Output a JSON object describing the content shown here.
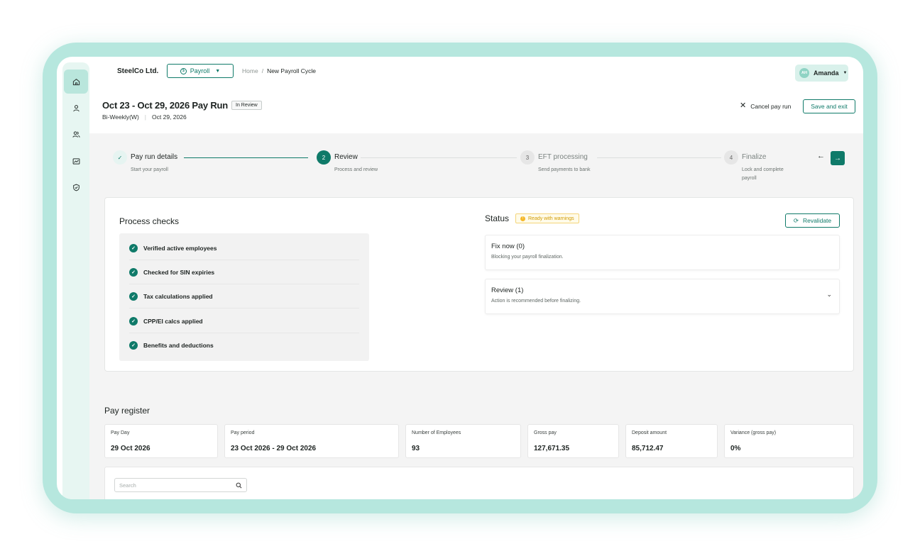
{
  "header": {
    "company": "SteelCo Ltd.",
    "module": "Payroll",
    "breadcrumb": {
      "home": "Home",
      "separator": "/",
      "current": "New Payroll Cycle"
    },
    "user": {
      "initials": "AH",
      "name": "Amanda"
    }
  },
  "sidebar": {
    "items": [
      {
        "icon": "home-icon",
        "active": true
      },
      {
        "icon": "person-icon",
        "active": false
      },
      {
        "icon": "people-icon",
        "active": false
      },
      {
        "icon": "chart-icon",
        "active": false
      },
      {
        "icon": "shield-icon",
        "active": false
      }
    ]
  },
  "run": {
    "title": "Oct 23 - Oct 29, 2026 Pay Run",
    "status": "In Review",
    "frequency": "Bi-Weekly(W)",
    "separator": "|",
    "pay_date": "Oct 29, 2026",
    "cancel_label": "Cancel pay run",
    "save_label": "Save and exit"
  },
  "stepper": {
    "steps": [
      {
        "number": "✓",
        "title": "Pay run details",
        "subtitle": "Start your payroll",
        "state": "done"
      },
      {
        "number": "2",
        "title": "Review",
        "subtitle": "Process and review",
        "state": "current"
      },
      {
        "number": "3",
        "title": "EFT processing",
        "subtitle": "Send payments to bank",
        "state": "todo"
      },
      {
        "number": "4",
        "title": "Finalize",
        "subtitle": "Lock and complete payroll",
        "state": "todo"
      }
    ]
  },
  "checks": {
    "title": "Process checks",
    "items": [
      "Verified active employees",
      "Checked for SIN expiries",
      "Tax calculations applied",
      "CPP/EI calcs applied",
      "Benefits and deductions"
    ]
  },
  "status": {
    "title": "Status",
    "badge": "Ready with warnings",
    "revalidate_label": "Revalidate",
    "issues": [
      {
        "title": "Fix now (0)",
        "subtitle": "Blocking your payroll finalization."
      },
      {
        "title": "Review (1)",
        "subtitle": "Action is recommended before finalizing."
      }
    ]
  },
  "register": {
    "title": "Pay register",
    "stats": [
      {
        "label": "Pay Day",
        "value": "29 Oct 2026"
      },
      {
        "label": "Pay period",
        "value": "23 Oct 2026 - 29 Oct 2026"
      },
      {
        "label": "Number of Employees",
        "value": "93"
      },
      {
        "label": "Gross pay",
        "value": "127,671.35"
      },
      {
        "label": "Deposit amount",
        "value": "85,712.47"
      },
      {
        "label": "Variance (gross pay)",
        "value": "0%"
      }
    ],
    "search_placeholder": "Search"
  },
  "colors": {
    "brand": "#0f7a69",
    "frame": "#b6e7de",
    "warning": "#f5b82a"
  }
}
